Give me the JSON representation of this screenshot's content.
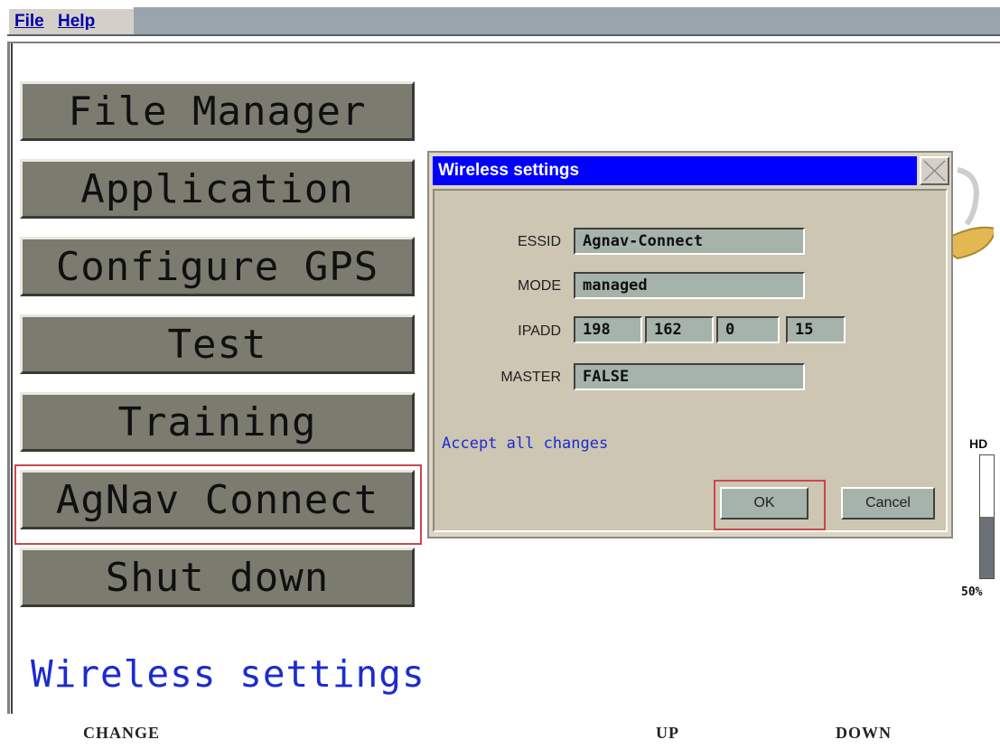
{
  "menubar": {
    "file_label": "File",
    "help_label": "Help"
  },
  "main_menu": {
    "items": [
      {
        "label": "File Manager"
      },
      {
        "label": "Application"
      },
      {
        "label": "Configure GPS"
      },
      {
        "label": "Test"
      },
      {
        "label": "Training"
      },
      {
        "label": "AgNav Connect"
      },
      {
        "label": "Shut down"
      }
    ],
    "selected": "AgNav Connect"
  },
  "status_text": "Wireless settings",
  "dialog": {
    "title": "Wireless settings",
    "essid_label": "ESSID",
    "essid_value": "Agnav-Connect",
    "mode_label": "MODE",
    "mode_value": "managed",
    "ipadd_label": "IPADD",
    "ip": [
      "198",
      "162",
      "0",
      "15"
    ],
    "master_label": "MASTER",
    "master_value": "FALSE",
    "accept_text": "Accept all changes",
    "ok_label": "OK",
    "cancel_label": "Cancel"
  },
  "hd_gauge": {
    "label": "HD",
    "value_text": "50%",
    "level": 0.5
  },
  "function_keys": {
    "change": "CHANGE",
    "up": "UP",
    "down": "DOWN"
  },
  "colors": {
    "dialog_title_bar": "#0000ff",
    "menu_button": "#7b7b6f",
    "field_bg": "#a6b3ab",
    "highlight": "#c8484f",
    "status_text": "#1c2bd0"
  }
}
